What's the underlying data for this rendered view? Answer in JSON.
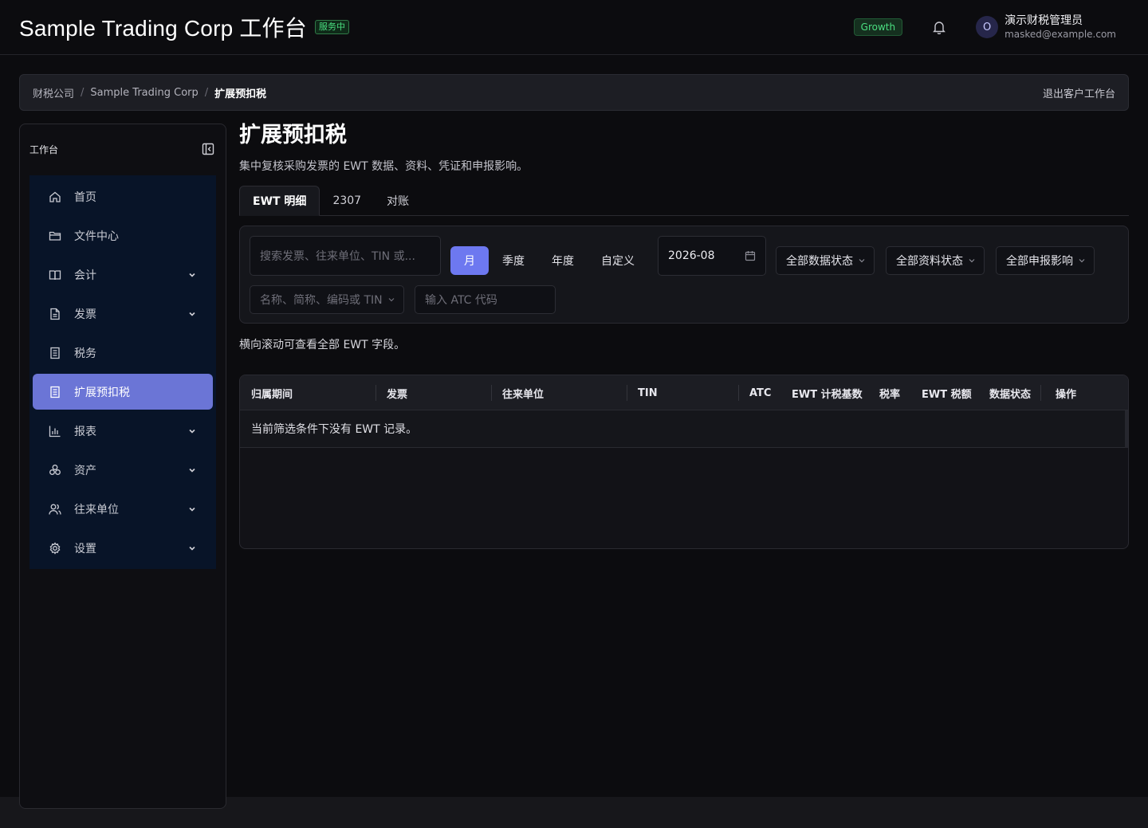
{
  "header": {
    "title": "Sample Trading Corp 工作台",
    "status_badge": "服务中",
    "plan_badge": "Growth",
    "user": {
      "avatar_initial": "O",
      "name": "演示财税管理员",
      "email": "masked@example.com"
    }
  },
  "breadcrumb": {
    "items": [
      "财税公司",
      "Sample Trading Corp",
      "扩展预扣税"
    ],
    "separator": "/",
    "exit_label": "退出客户工作台"
  },
  "sidebar": {
    "title": "工作台",
    "items": [
      {
        "label": "首页",
        "icon": "home-icon",
        "has_children": false,
        "active": false
      },
      {
        "label": "文件中心",
        "icon": "folder-icon",
        "has_children": false,
        "active": false
      },
      {
        "label": "会计",
        "icon": "book-icon",
        "has_children": true,
        "active": false
      },
      {
        "label": "发票",
        "icon": "document-icon",
        "has_children": true,
        "active": false
      },
      {
        "label": "税务",
        "icon": "list-icon",
        "has_children": false,
        "active": false
      },
      {
        "label": "扩展预扣税",
        "icon": "list-icon",
        "has_children": false,
        "active": true
      },
      {
        "label": "报表",
        "icon": "bar-chart-icon",
        "has_children": true,
        "active": false
      },
      {
        "label": "资产",
        "icon": "cubes-icon",
        "has_children": true,
        "active": false
      },
      {
        "label": "往来单位",
        "icon": "users-icon",
        "has_children": true,
        "active": false
      },
      {
        "label": "设置",
        "icon": "gear-icon",
        "has_children": true,
        "active": false
      }
    ]
  },
  "main": {
    "title": "扩展预扣税",
    "description": "集中复核采购发票的 EWT 数据、资料、凭证和申报影响。",
    "tabs": [
      {
        "label": "EWT 明细",
        "active": true
      },
      {
        "label": "2307",
        "active": false
      },
      {
        "label": "对账",
        "active": false
      }
    ],
    "filters": {
      "search_placeholder": "搜索发票、往来单位、TIN 或...",
      "period_options": [
        {
          "label": "月",
          "active": true
        },
        {
          "label": "季度",
          "active": false
        },
        {
          "label": "年度",
          "active": false
        },
        {
          "label": "自定义",
          "active": false
        }
      ],
      "date_value": "2026-08",
      "data_status": "全部数据状态",
      "doc_status": "全部资料状态",
      "filing_impact": "全部申报影响",
      "counterparty_placeholder": "名称、简称、编码或 TIN",
      "atc_placeholder": "输入 ATC 代码"
    },
    "scroll_hint": "横向滚动可查看全部 EWT 字段。",
    "table": {
      "columns": [
        "归属期间",
        "发票",
        "往来单位",
        "TIN",
        "ATC",
        "EWT 计税基数",
        "税率",
        "EWT 税额",
        "数据状态",
        "操作"
      ],
      "empty_message": "当前筛选条件下没有 EWT 记录。"
    }
  },
  "colors": {
    "accent": "#6b75d6",
    "accent_button": "#6d78f0",
    "success": "#4ade80",
    "nav_bg": "#081428"
  }
}
